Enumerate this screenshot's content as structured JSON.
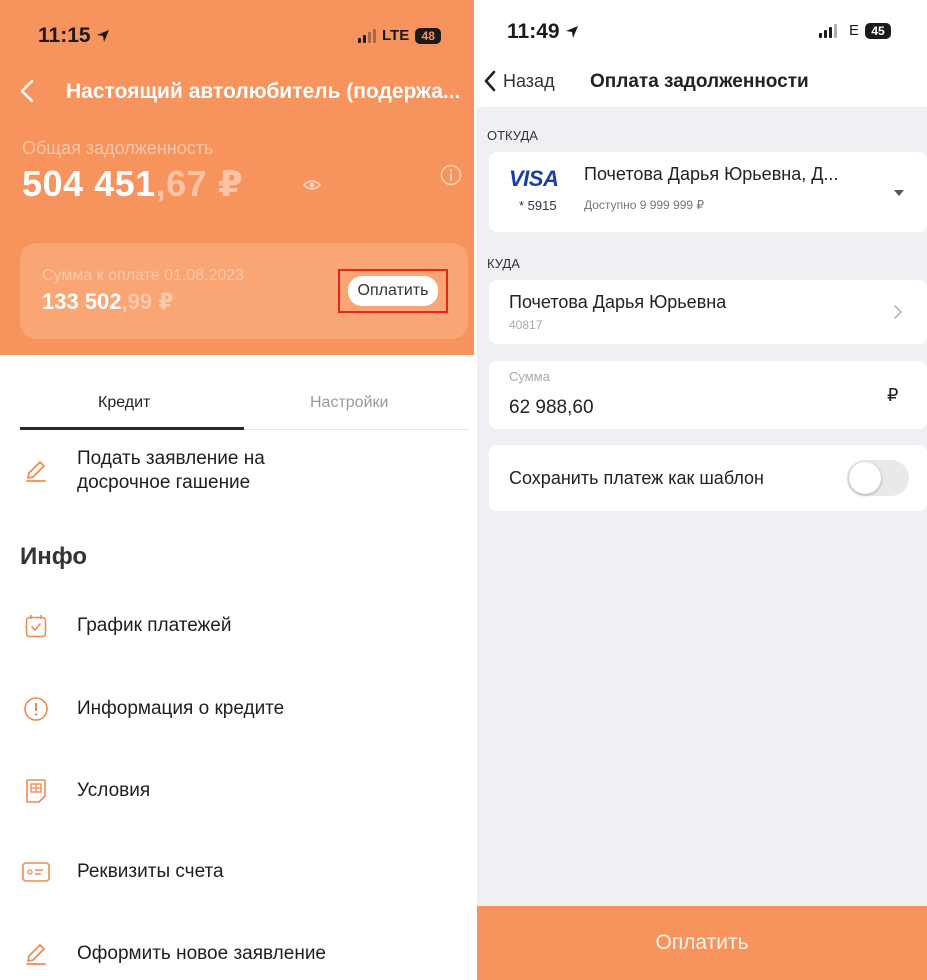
{
  "left": {
    "status": {
      "time": "11:15",
      "network": "LTE",
      "battery": "48"
    },
    "title": "Настоящий автолюбитель (подержа...",
    "debt": {
      "label": "Общая задолженность",
      "whole": "504 451",
      "fraction": ",67 ₽"
    },
    "payment": {
      "label": "Сумма к оплате 01.08.2023",
      "whole": "133 502",
      "fraction": ",99 ₽",
      "button": "Оплатить"
    },
    "tabs": {
      "credit": "Кредит",
      "settings": "Настройки"
    },
    "early_repayment": "Подать заявление на досрочное гашение",
    "info_heading": "Инфо",
    "menu": {
      "schedule": "График платежей",
      "credit_info": "Информация о кредите",
      "terms": "Условия",
      "requisites": "Реквизиты счета",
      "new_application": "Оформить новое заявление"
    },
    "accent_color": "#f7935c"
  },
  "right": {
    "status": {
      "time": "11:49",
      "network": "E",
      "battery": "45"
    },
    "back": "Назад",
    "title": "Оплата задолженности",
    "from": {
      "caption": "ОТКУДА",
      "brand": "VISA",
      "name": "Почетова Дарья Юрьевна, Д...",
      "mask": "* 5915",
      "available": "Доступно 9 999 999 ₽"
    },
    "to": {
      "caption": "КУДА",
      "name": "Почетова Дарья Юрьевна",
      "account": "40817"
    },
    "sum": {
      "label": "Сумма",
      "value": "62 988,60",
      "currency": "₽"
    },
    "template_label": "Сохранить платеж как шаблон",
    "template_enabled": false,
    "pay_button": "Оплатить"
  }
}
